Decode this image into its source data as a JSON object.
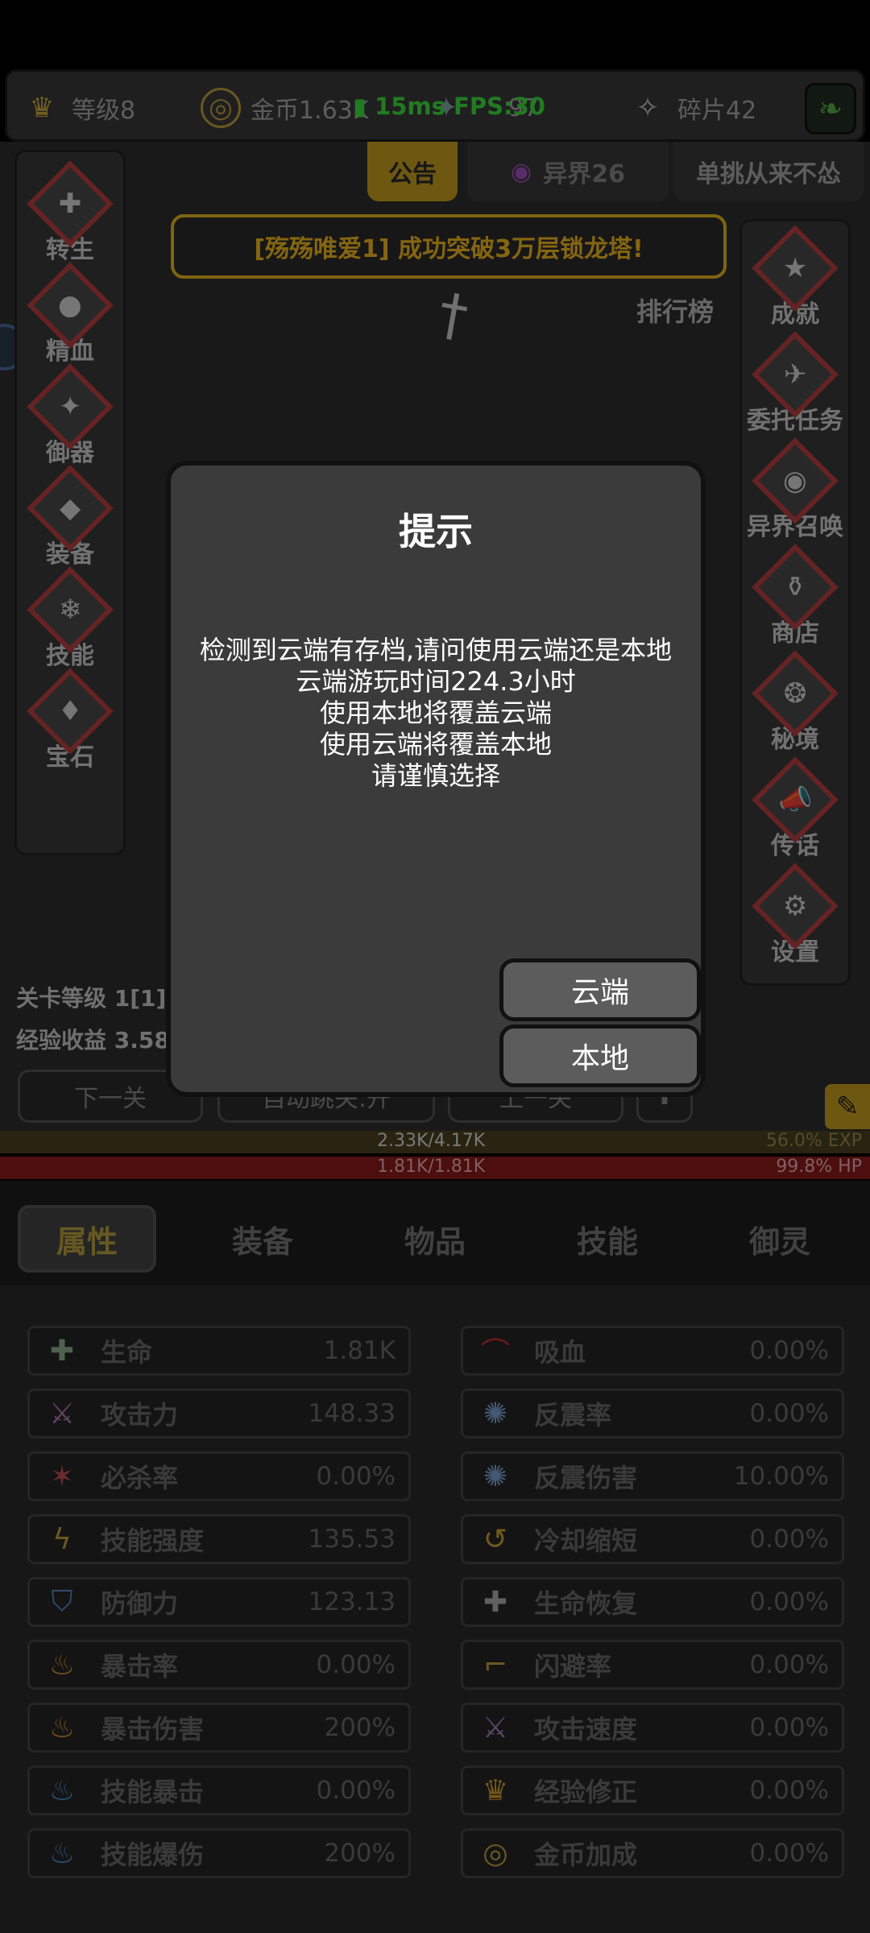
{
  "hud": {
    "level": "等级8",
    "gold": "金币1.63K",
    "currency3": "97",
    "shards": "碎片42",
    "ping": "15ms",
    "fps": "FPS:30"
  },
  "top_tabs": {
    "notice": "公告",
    "otherworld": "异界26",
    "duel": "单挑从来不怂"
  },
  "banner": "[殇殇唯爱1] 成功突破3万层锁龙塔!",
  "left_menu": [
    {
      "label": "转生",
      "icon": "rebirth-icon",
      "glyph": "✚"
    },
    {
      "label": "精血",
      "icon": "blood-icon",
      "glyph": "●"
    },
    {
      "label": "御器",
      "icon": "artifact-icon",
      "glyph": "✦"
    },
    {
      "label": "装备",
      "icon": "armor-icon",
      "glyph": "◆"
    },
    {
      "label": "技能",
      "icon": "skill-icon",
      "glyph": "❄"
    },
    {
      "label": "宝石",
      "icon": "gem-icon",
      "glyph": "♦"
    }
  ],
  "right_menu": [
    {
      "label": "成就",
      "icon": "achievement-icon",
      "glyph": "★"
    },
    {
      "label": "委托任务",
      "icon": "quest-icon",
      "glyph": "✈"
    },
    {
      "label": "异界召唤",
      "icon": "summon-icon",
      "glyph": "◉"
    },
    {
      "label": "商店",
      "icon": "shop-icon",
      "glyph": "⚱"
    },
    {
      "label": "秘境",
      "icon": "secret-realm-icon",
      "glyph": "❂"
    },
    {
      "label": "传话",
      "icon": "megaphone-icon",
      "glyph": "📣"
    },
    {
      "label": "设置",
      "icon": "gear-icon",
      "glyph": "⚙"
    }
  ],
  "ranking": "排行榜",
  "stage": {
    "level_label": "关卡等级 1[1]",
    "exp_label": "经验收益 3.58"
  },
  "bottom_buttons": {
    "next": "下一关",
    "auto": "自动跳关:开",
    "prev": "上一关"
  },
  "bars": {
    "exp_text": "2.33K/4.17K",
    "exp_pct": "56.0% EXP",
    "hp_text": "1.81K/1.81K",
    "hp_pct": "99.8% HP"
  },
  "tabs": [
    "属性",
    "装备",
    "物品",
    "技能",
    "御灵"
  ],
  "stats_left": [
    {
      "name": "生命",
      "value": "1.81K",
      "icon": "life-icon",
      "glyph": "✚",
      "color": "#8fb08f"
    },
    {
      "name": "攻击力",
      "value": "148.33",
      "icon": "sword-icon",
      "glyph": "⚔",
      "color": "#b07ab0"
    },
    {
      "name": "必杀率",
      "value": "0.00%",
      "icon": "slash-icon",
      "glyph": "✶",
      "color": "#c05050"
    },
    {
      "name": "技能强度",
      "value": "135.53",
      "icon": "lightning-icon",
      "glyph": "ϟ",
      "color": "#c0a040"
    },
    {
      "name": "防御力",
      "value": "123.13",
      "icon": "shield-icon",
      "glyph": "⛉",
      "color": "#5a8ac0"
    },
    {
      "name": "暴击率",
      "value": "0.00%",
      "icon": "flame-icon",
      "glyph": "♨",
      "color": "#d09030"
    },
    {
      "name": "暴击伤害",
      "value": "200%",
      "icon": "flame-icon",
      "glyph": "♨",
      "color": "#d09030"
    },
    {
      "name": "技能暴击",
      "value": "0.00%",
      "icon": "blue-flame-icon",
      "glyph": "♨",
      "color": "#4a8ad0"
    },
    {
      "name": "技能爆伤",
      "value": "200%",
      "icon": "blue-flame-icon",
      "glyph": "♨",
      "color": "#4a8ad0"
    }
  ],
  "stats_right": [
    {
      "name": "吸血",
      "value": "0.00%",
      "icon": "bat-icon",
      "glyph": "⌒",
      "color": "#c03030"
    },
    {
      "name": "反震率",
      "value": "0.00%",
      "icon": "burst-icon",
      "glyph": "✺",
      "color": "#7aa0d0"
    },
    {
      "name": "反震伤害",
      "value": "10.00%",
      "icon": "burst-icon",
      "glyph": "✺",
      "color": "#7aa0d0"
    },
    {
      "name": "冷却缩短",
      "value": "0.00%",
      "icon": "cooldown-icon",
      "glyph": "↺",
      "color": "#d0a030"
    },
    {
      "name": "生命恢复",
      "value": "0.00%",
      "icon": "regen-icon",
      "glyph": "✚",
      "color": "#b0b0b0"
    },
    {
      "name": "闪避率",
      "value": "0.00%",
      "icon": "boot-icon",
      "glyph": "⌐",
      "color": "#c0a040"
    },
    {
      "name": "攻击速度",
      "value": "0.00%",
      "icon": "swords-icon",
      "glyph": "⚔",
      "color": "#a080c0"
    },
    {
      "name": "经验修正",
      "value": "0.00%",
      "icon": "crown-icon",
      "glyph": "♛",
      "color": "#d0a030"
    },
    {
      "name": "金币加成",
      "value": "0.00%",
      "icon": "coin-icon",
      "glyph": "◎",
      "color": "#c0a040"
    }
  ],
  "modal": {
    "title": "提示",
    "lines": [
      "检测到云端有存档,请问使用云端还是本地",
      "云端游玩时间224.3小时",
      "使用本地将覆盖云端",
      "使用云端将覆盖本地",
      "请谨慎选择"
    ],
    "cloud_button": "云端",
    "local_button": "本地"
  }
}
